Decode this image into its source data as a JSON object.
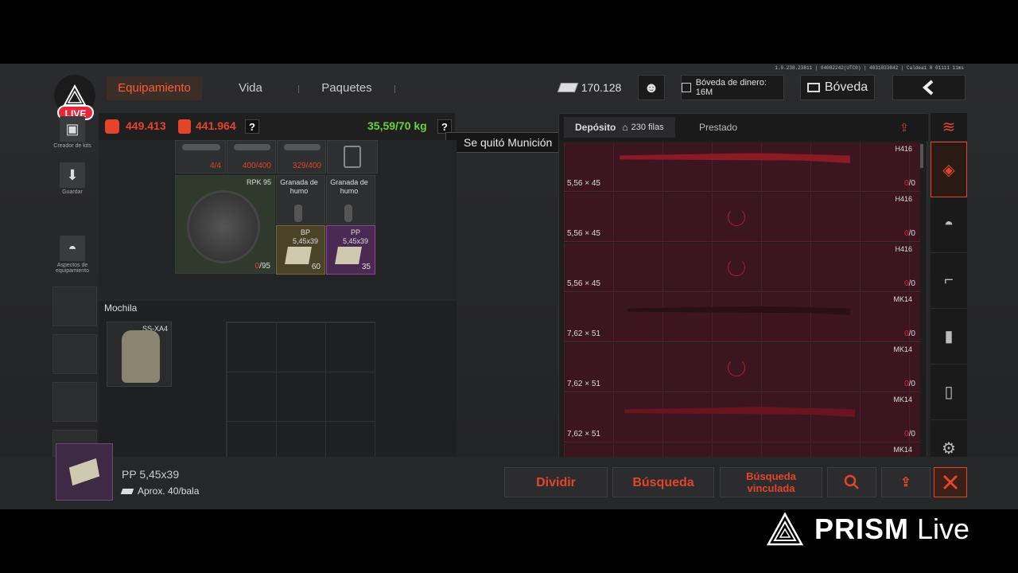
{
  "version_info": "1.0.238.23811 | 04082242(UTC0) | 4031033842 | Caldea1 8 01111 11ms",
  "nav": {
    "tabs": [
      {
        "label": "Equipamiento",
        "active": true
      },
      {
        "label": "Vida",
        "active": false
      },
      {
        "label": "Paquetes",
        "active": false
      }
    ]
  },
  "header": {
    "currency_value": "170.128",
    "vault_money_label": "Bóveda de dinero: 16M",
    "vault_button": "Bóveda"
  },
  "live_badge": "LIVE",
  "sidebar": {
    "items": [
      {
        "label": "Creador de kits",
        "icon": "kit-icon"
      },
      {
        "label": "Guardar",
        "icon": "download-icon"
      },
      {
        "label": "Aspectos de equipamiento",
        "icon": "helmet-icon"
      }
    ]
  },
  "stats": {
    "value_1": "449.413",
    "value_2": "441.964",
    "weight": "35,59/70 kg",
    "help": "?"
  },
  "tooltip": "Se quitó Munición",
  "loadout": {
    "top_cells": [
      {
        "count": "4/4"
      },
      {
        "count": "400/400"
      },
      {
        "count": "329/400"
      }
    ],
    "rpk": {
      "label": "RPK 95",
      "count_red": "0",
      "count_rest": "/95"
    },
    "smoke_1": {
      "label": "Granada de humo"
    },
    "smoke_2": {
      "label": "Granada de humo"
    },
    "ammo_1": {
      "label": "BP 5,45x39",
      "count": "60"
    },
    "ammo_2": {
      "label": "PP 5,45x39",
      "count": "35"
    }
  },
  "backpack": {
    "title": "Mochila",
    "item_label": "SS-XA4"
  },
  "deposit": {
    "tab_active": "Depósito",
    "rows_label": "230 filas",
    "tab_other": "Prestado",
    "rows": [
      {
        "caliber": "5,56 × 45",
        "name": "H416",
        "dur_red": "0",
        "dur_rest": "/0",
        "has_image": true
      },
      {
        "caliber": "5,56 × 45",
        "name": "H416",
        "dur_red": "0",
        "dur_rest": "/0",
        "has_image": false
      },
      {
        "caliber": "5,56 × 45",
        "name": "H416",
        "dur_red": "0",
        "dur_rest": "/0",
        "has_image": false
      },
      {
        "caliber": "7,62 × 51",
        "name": "MK14",
        "dur_red": "0",
        "dur_rest": "/0",
        "has_image": true
      },
      {
        "caliber": "7,62 × 51",
        "name": "MK14",
        "dur_red": "0",
        "dur_rest": "/0",
        "has_image": false
      },
      {
        "caliber": "7,62 × 51",
        "name": "MK14",
        "dur_red": "0",
        "dur_rest": "/0",
        "has_image": true
      },
      {
        "caliber": "",
        "name": "MK14",
        "dur_red": "",
        "dur_rest": "",
        "has_image": false
      }
    ]
  },
  "selected_item": {
    "name": "PP 5,45x39",
    "price": "Aprox. 40/bala"
  },
  "actions": {
    "split": "Dividir",
    "search": "Búsqueda",
    "linked_search": "Búsqueda vinculada"
  },
  "watermark": {
    "brand": "PRISM",
    "suffix": "Live"
  },
  "colors": {
    "accent": "#ff5a36",
    "weight_green": "#6cd23a",
    "deposit_row": "#3b1620"
  }
}
